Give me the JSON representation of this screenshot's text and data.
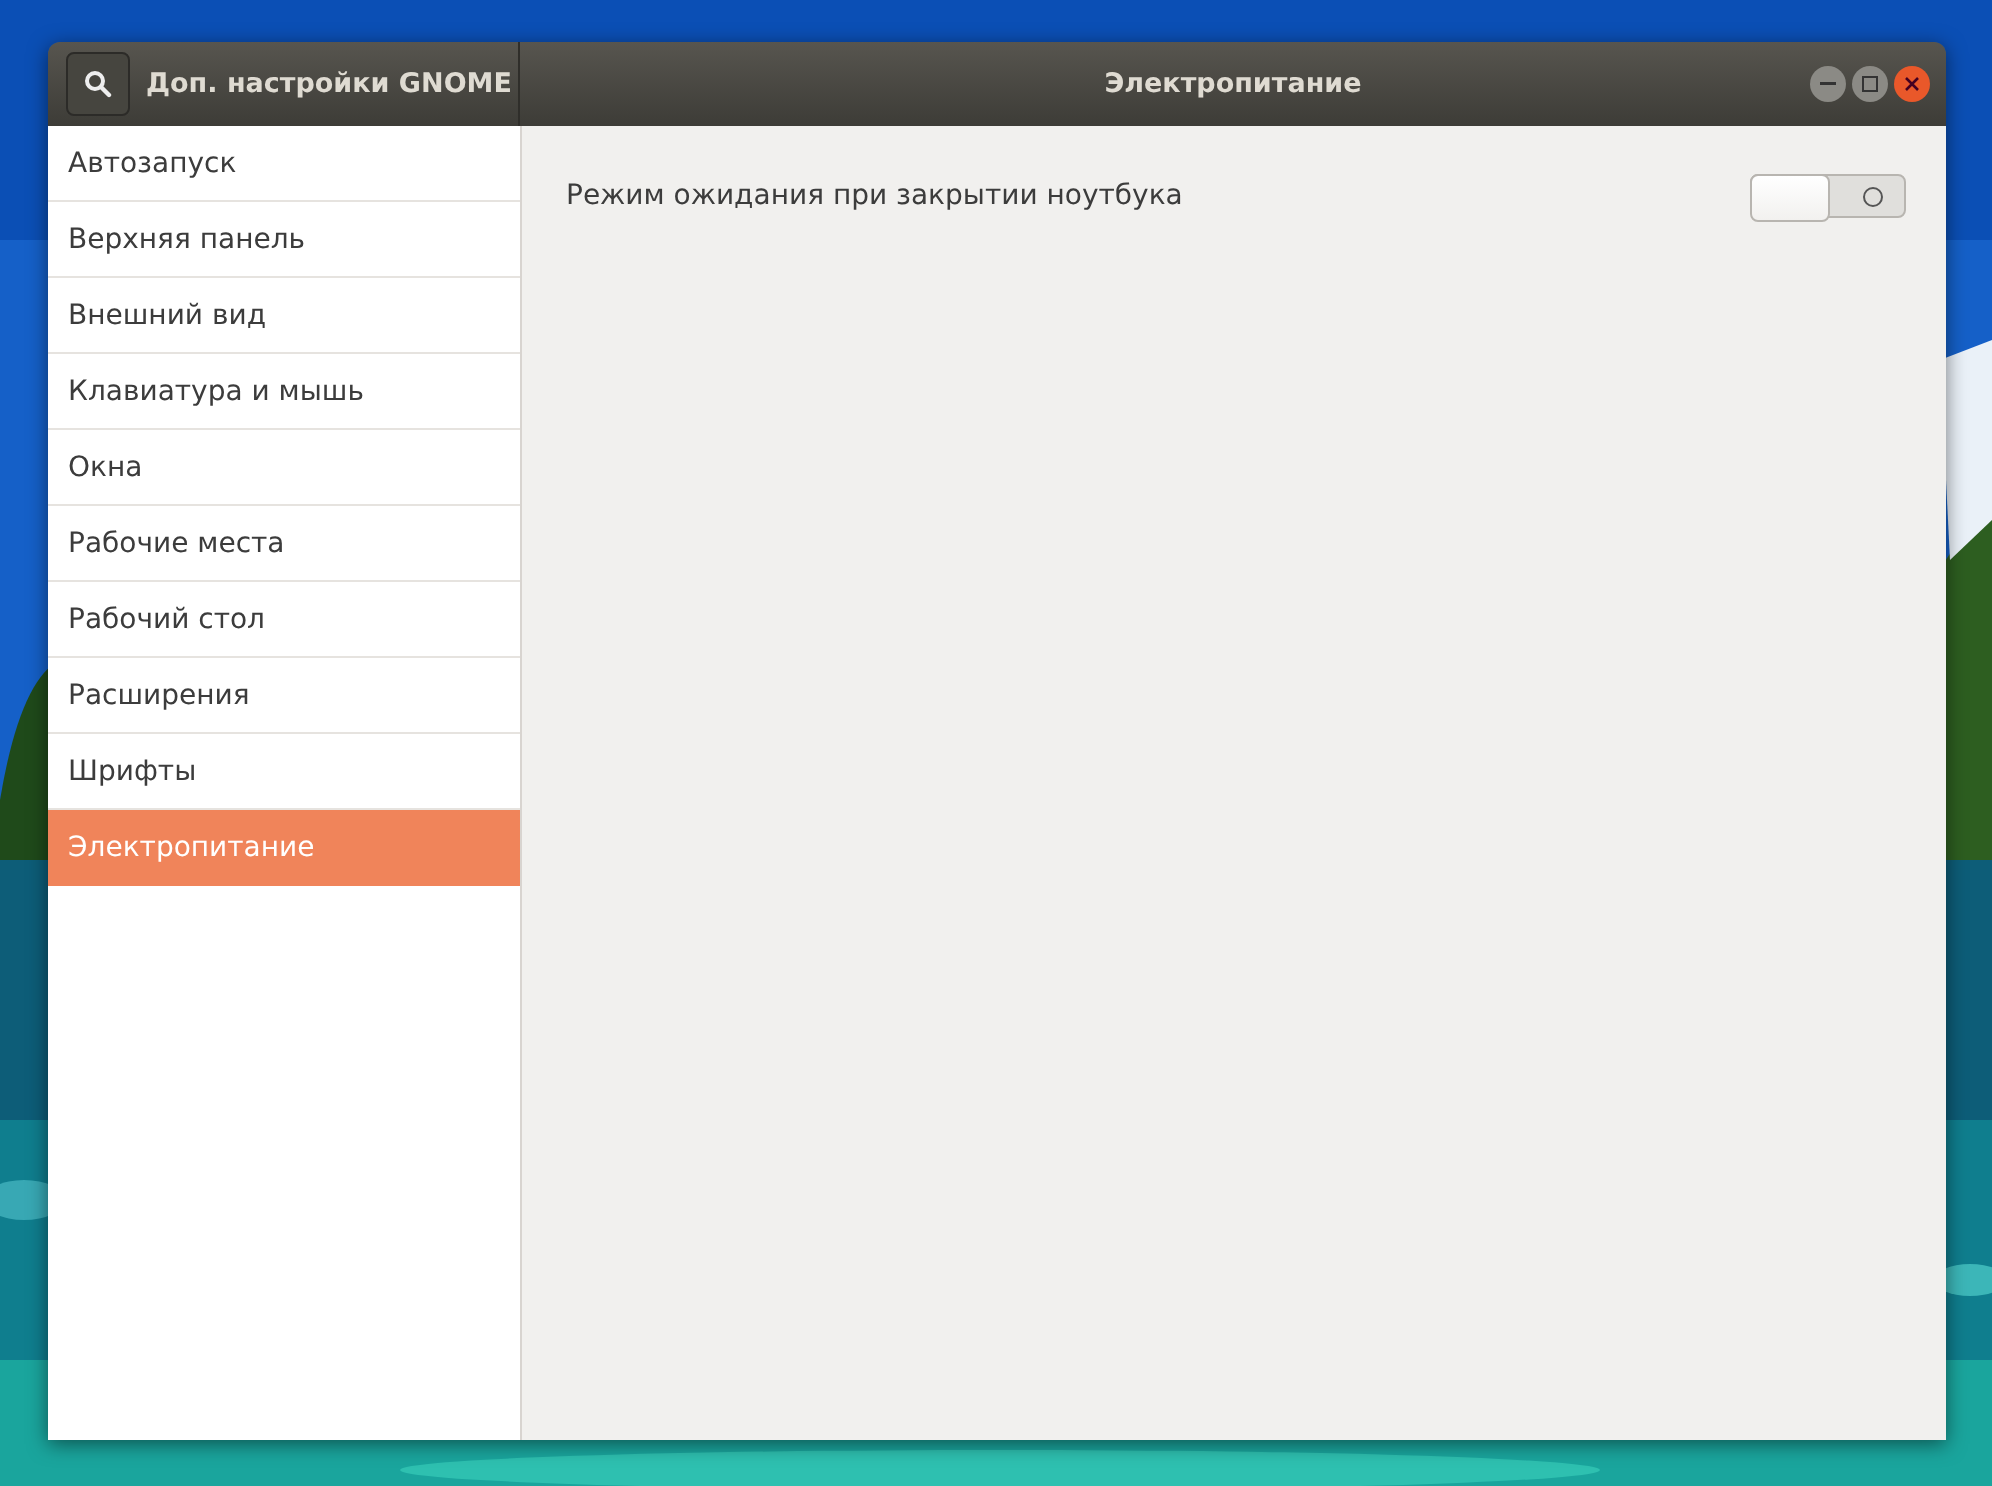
{
  "window": {
    "title": "Доп. настройки GNOME",
    "page_title": "Электропитание"
  },
  "sidebar": {
    "items": [
      {
        "label": "Автозапуск",
        "selected": false
      },
      {
        "label": "Верхняя панель",
        "selected": false
      },
      {
        "label": "Внешний вид",
        "selected": false
      },
      {
        "label": "Клавиатура и мышь",
        "selected": false
      },
      {
        "label": "Окна",
        "selected": false
      },
      {
        "label": "Рабочие места",
        "selected": false
      },
      {
        "label": "Рабочий стол",
        "selected": false
      },
      {
        "label": "Расширения",
        "selected": false
      },
      {
        "label": "Шрифты",
        "selected": false
      },
      {
        "label": "Электропитание",
        "selected": true
      }
    ]
  },
  "settings": [
    {
      "kind": "switch",
      "label": "Режим ожидания при закрытии ноутбука",
      "on": false
    }
  ]
}
